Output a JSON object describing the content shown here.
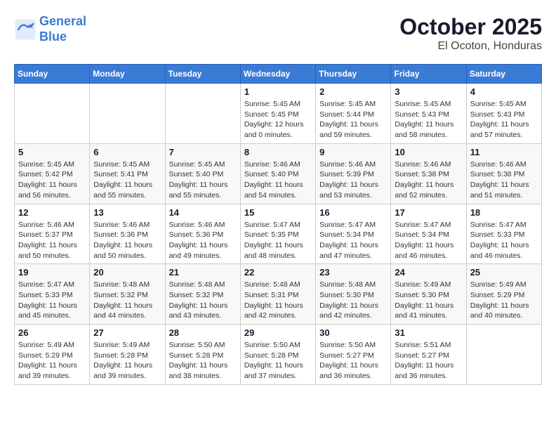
{
  "header": {
    "logo_line1": "General",
    "logo_line2": "Blue",
    "month": "October 2025",
    "location": "El Ocoton, Honduras"
  },
  "weekdays": [
    "Sunday",
    "Monday",
    "Tuesday",
    "Wednesday",
    "Thursday",
    "Friday",
    "Saturday"
  ],
  "weeks": [
    [
      {
        "day": "",
        "info": ""
      },
      {
        "day": "",
        "info": ""
      },
      {
        "day": "",
        "info": ""
      },
      {
        "day": "1",
        "info": "Sunrise: 5:45 AM\nSunset: 5:45 PM\nDaylight: 12 hours\nand 0 minutes."
      },
      {
        "day": "2",
        "info": "Sunrise: 5:45 AM\nSunset: 5:44 PM\nDaylight: 11 hours\nand 59 minutes."
      },
      {
        "day": "3",
        "info": "Sunrise: 5:45 AM\nSunset: 5:43 PM\nDaylight: 11 hours\nand 58 minutes."
      },
      {
        "day": "4",
        "info": "Sunrise: 5:45 AM\nSunset: 5:43 PM\nDaylight: 11 hours\nand 57 minutes."
      }
    ],
    [
      {
        "day": "5",
        "info": "Sunrise: 5:45 AM\nSunset: 5:42 PM\nDaylight: 11 hours\nand 56 minutes."
      },
      {
        "day": "6",
        "info": "Sunrise: 5:45 AM\nSunset: 5:41 PM\nDaylight: 11 hours\nand 55 minutes."
      },
      {
        "day": "7",
        "info": "Sunrise: 5:45 AM\nSunset: 5:40 PM\nDaylight: 11 hours\nand 55 minutes."
      },
      {
        "day": "8",
        "info": "Sunrise: 5:46 AM\nSunset: 5:40 PM\nDaylight: 11 hours\nand 54 minutes."
      },
      {
        "day": "9",
        "info": "Sunrise: 5:46 AM\nSunset: 5:39 PM\nDaylight: 11 hours\nand 53 minutes."
      },
      {
        "day": "10",
        "info": "Sunrise: 5:46 AM\nSunset: 5:38 PM\nDaylight: 11 hours\nand 52 minutes."
      },
      {
        "day": "11",
        "info": "Sunrise: 5:46 AM\nSunset: 5:38 PM\nDaylight: 11 hours\nand 51 minutes."
      }
    ],
    [
      {
        "day": "12",
        "info": "Sunrise: 5:46 AM\nSunset: 5:37 PM\nDaylight: 11 hours\nand 50 minutes."
      },
      {
        "day": "13",
        "info": "Sunrise: 5:46 AM\nSunset: 5:36 PM\nDaylight: 11 hours\nand 50 minutes."
      },
      {
        "day": "14",
        "info": "Sunrise: 5:46 AM\nSunset: 5:36 PM\nDaylight: 11 hours\nand 49 minutes."
      },
      {
        "day": "15",
        "info": "Sunrise: 5:47 AM\nSunset: 5:35 PM\nDaylight: 11 hours\nand 48 minutes."
      },
      {
        "day": "16",
        "info": "Sunrise: 5:47 AM\nSunset: 5:34 PM\nDaylight: 11 hours\nand 47 minutes."
      },
      {
        "day": "17",
        "info": "Sunrise: 5:47 AM\nSunset: 5:34 PM\nDaylight: 11 hours\nand 46 minutes."
      },
      {
        "day": "18",
        "info": "Sunrise: 5:47 AM\nSunset: 5:33 PM\nDaylight: 11 hours\nand 46 minutes."
      }
    ],
    [
      {
        "day": "19",
        "info": "Sunrise: 5:47 AM\nSunset: 5:33 PM\nDaylight: 11 hours\nand 45 minutes."
      },
      {
        "day": "20",
        "info": "Sunrise: 5:48 AM\nSunset: 5:32 PM\nDaylight: 11 hours\nand 44 minutes."
      },
      {
        "day": "21",
        "info": "Sunrise: 5:48 AM\nSunset: 5:32 PM\nDaylight: 11 hours\nand 43 minutes."
      },
      {
        "day": "22",
        "info": "Sunrise: 5:48 AM\nSunset: 5:31 PM\nDaylight: 11 hours\nand 42 minutes."
      },
      {
        "day": "23",
        "info": "Sunrise: 5:48 AM\nSunset: 5:30 PM\nDaylight: 11 hours\nand 42 minutes."
      },
      {
        "day": "24",
        "info": "Sunrise: 5:49 AM\nSunset: 5:30 PM\nDaylight: 11 hours\nand 41 minutes."
      },
      {
        "day": "25",
        "info": "Sunrise: 5:49 AM\nSunset: 5:29 PM\nDaylight: 11 hours\nand 40 minutes."
      }
    ],
    [
      {
        "day": "26",
        "info": "Sunrise: 5:49 AM\nSunset: 5:29 PM\nDaylight: 11 hours\nand 39 minutes."
      },
      {
        "day": "27",
        "info": "Sunrise: 5:49 AM\nSunset: 5:28 PM\nDaylight: 11 hours\nand 39 minutes."
      },
      {
        "day": "28",
        "info": "Sunrise: 5:50 AM\nSunset: 5:28 PM\nDaylight: 11 hours\nand 38 minutes."
      },
      {
        "day": "29",
        "info": "Sunrise: 5:50 AM\nSunset: 5:28 PM\nDaylight: 11 hours\nand 37 minutes."
      },
      {
        "day": "30",
        "info": "Sunrise: 5:50 AM\nSunset: 5:27 PM\nDaylight: 11 hours\nand 36 minutes."
      },
      {
        "day": "31",
        "info": "Sunrise: 5:51 AM\nSunset: 5:27 PM\nDaylight: 11 hours\nand 36 minutes."
      },
      {
        "day": "",
        "info": ""
      }
    ]
  ]
}
